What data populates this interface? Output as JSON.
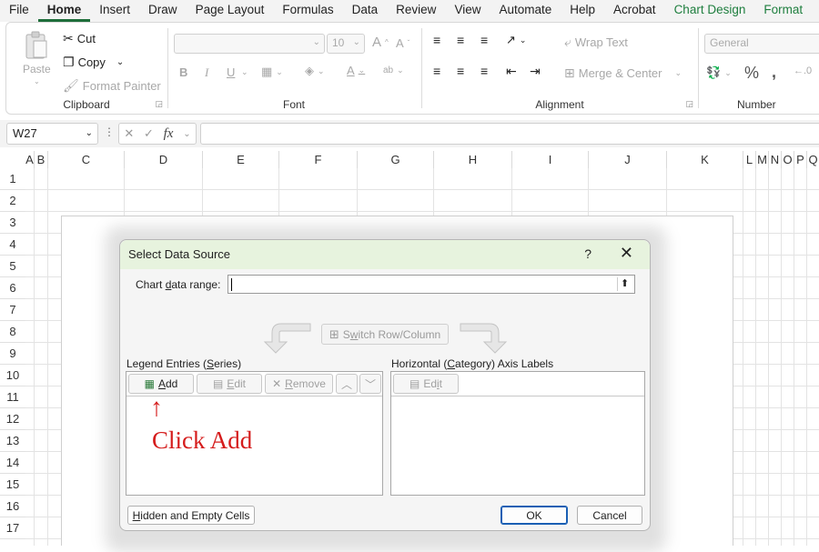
{
  "menu": [
    "File",
    "Home",
    "Insert",
    "Draw",
    "Page Layout",
    "Formulas",
    "Data",
    "Review",
    "View",
    "Automate",
    "Help",
    "Acrobat",
    "Chart Design",
    "Format"
  ],
  "ribbon": {
    "clipboard": {
      "paste": "Paste",
      "cut": "Cut",
      "copy": "Copy",
      "format_painter": "Format Painter",
      "label": "Clipboard"
    },
    "font": {
      "size": "10",
      "label": "Font",
      "bold": "B",
      "italic": "I",
      "underline": "U"
    },
    "alignment": {
      "wrap_text": "Wrap Text",
      "merge_center": "Merge & Center",
      "label": "Alignment"
    },
    "number": {
      "format": "General",
      "percent": "%",
      "label": "Number"
    }
  },
  "formula_bar": {
    "cell": "W27",
    "fx": "fx"
  },
  "sheet": {
    "columns": [
      "A",
      "B",
      "C",
      "D",
      "E",
      "F",
      "G",
      "H",
      "I",
      "J",
      "K",
      "L",
      "M",
      "N",
      "O",
      "P",
      "Q"
    ],
    "rows": [
      "1",
      "2",
      "3",
      "4",
      "5",
      "6",
      "7",
      "8",
      "9",
      "10",
      "11",
      "12",
      "13",
      "14",
      "15",
      "16",
      "17"
    ]
  },
  "dialog": {
    "title": "Select Data Source",
    "help": "?",
    "chart_range_label_pre": "Chart ",
    "chart_range_label_u": "d",
    "chart_range_label_post": "ata range:",
    "switch_pre": "S",
    "switch_u": "w",
    "switch_post": "itch Row/Column",
    "legend_label_pre": "Legend Entries (",
    "legend_label_u": "S",
    "legend_label_post": "eries)",
    "axis_label_pre": "Horizontal (",
    "axis_label_u": "C",
    "axis_label_post": "ategory) Axis Labels",
    "add_u": "A",
    "add_post": "dd",
    "edit_u": "E",
    "edit_post": "dit",
    "remove_u": "R",
    "remove_post": "emove",
    "axis_edit_pre": "Ed",
    "axis_edit_u": "i",
    "axis_edit_post": "t",
    "hidden_u": "H",
    "hidden_post": "idden and Empty Cells",
    "ok": "OK",
    "cancel": "Cancel"
  },
  "annotation": {
    "arrow": "↑",
    "text": "Click Add"
  }
}
